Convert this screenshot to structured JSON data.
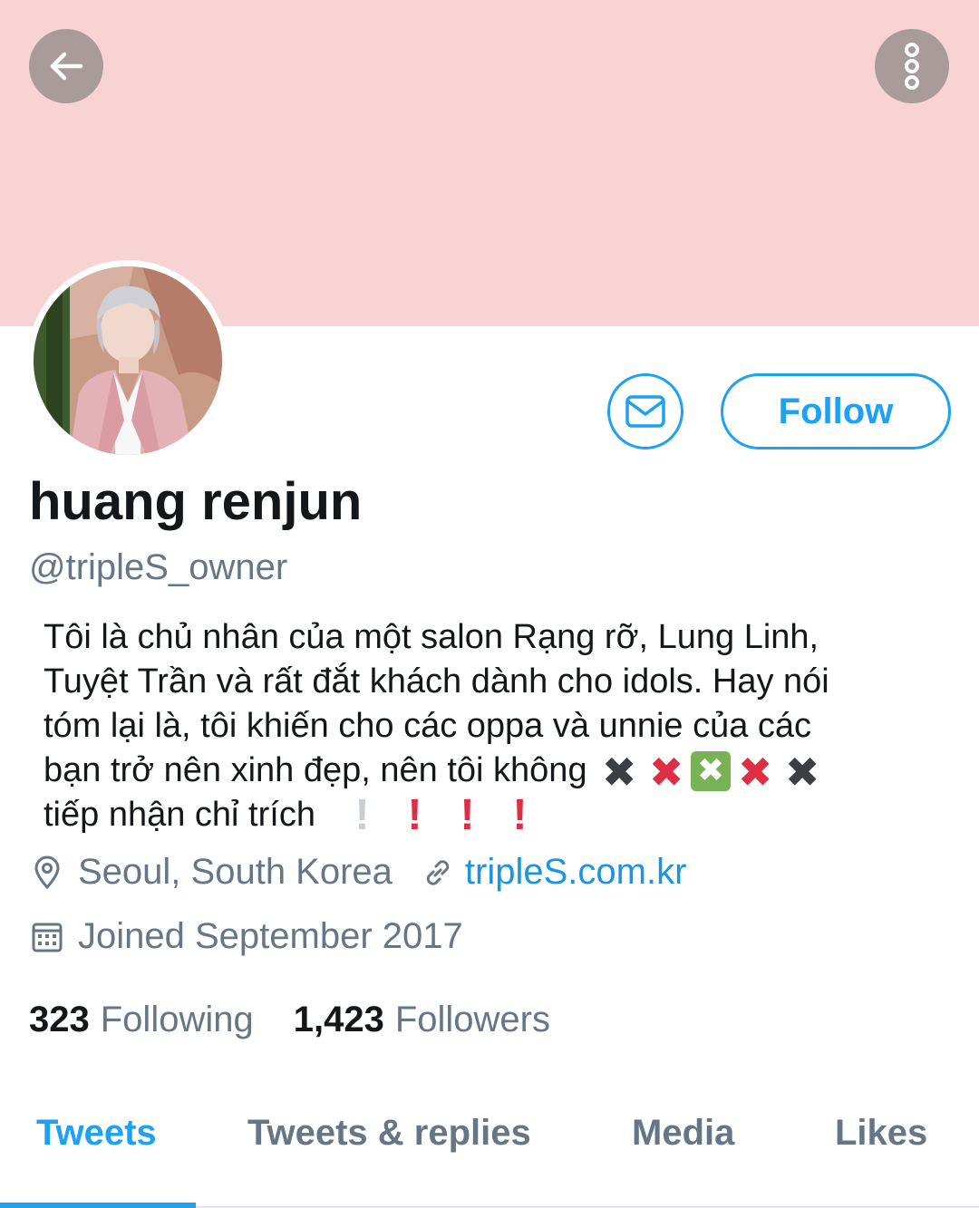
{
  "header": {
    "banner_color": "#f7d4d3",
    "back_icon": "arrow-left-icon",
    "more_icon": "more-vertical-icon"
  },
  "profile": {
    "display_name": "huang renjun",
    "handle": "@tripleS_owner",
    "bio_lines": [
      "Tôi là chủ nhân của một salon Rạng rỡ, Lung Linh,",
      "Tuyệt Trần và rất đắt khách dành cho idols. Hay nói",
      "tóm lại là, tôi khiến cho các oppa và unnie của các",
      "bạn trở nên xinh đẹp, nên tôi không",
      "tiếp nhận chỉ trích"
    ],
    "location": "Seoul, South Korea",
    "website": "tripleS.com.kr",
    "joined": "Joined September 2017"
  },
  "actions": {
    "follow_label": "Follow",
    "message_icon": "envelope-icon",
    "accent_color": "#1da1f2"
  },
  "stats": {
    "following_count": "323",
    "following_label": "Following",
    "followers_count": "1,423",
    "followers_label": "Followers"
  },
  "tabs": [
    {
      "label": "Tweets",
      "active": true
    },
    {
      "label": "Tweets & replies",
      "active": false
    },
    {
      "label": "Media",
      "active": false
    },
    {
      "label": "Likes",
      "active": false
    }
  ]
}
